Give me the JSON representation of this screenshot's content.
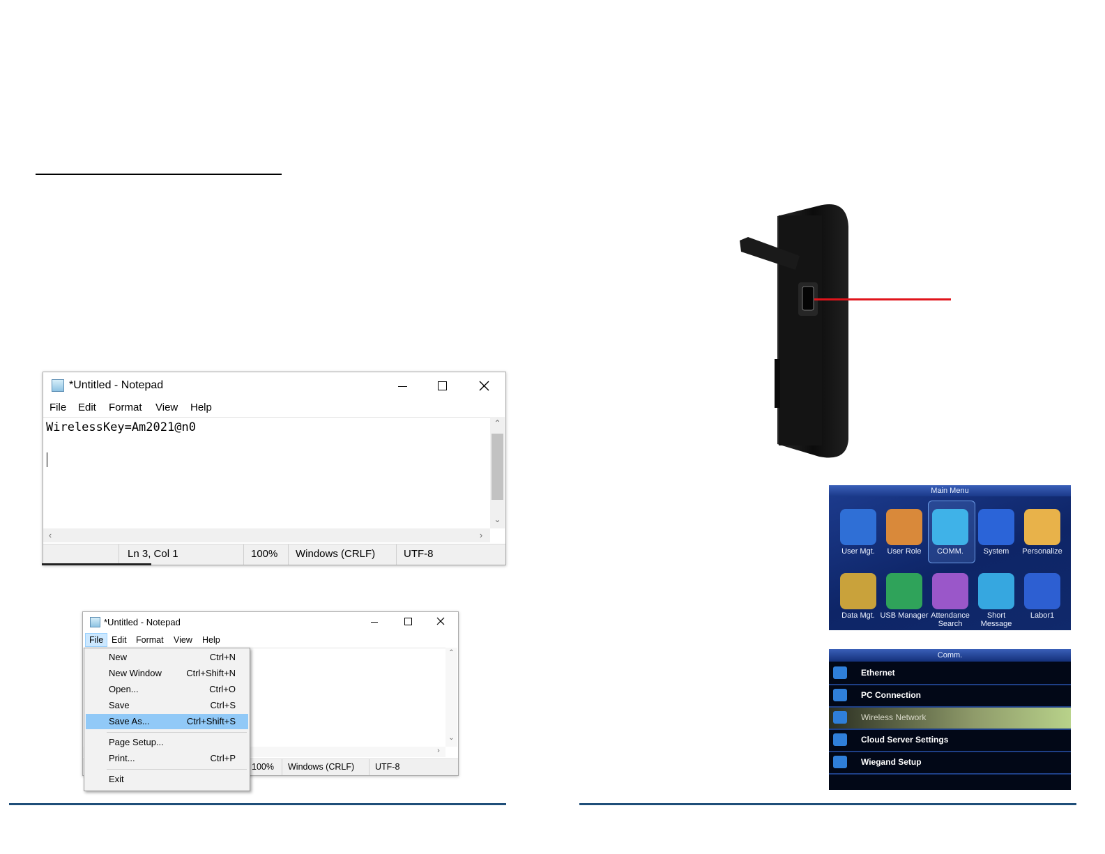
{
  "notepad_large": {
    "title": "*Untitled - Notepad",
    "menu": [
      "File",
      "Edit",
      "Format",
      "View",
      "Help"
    ],
    "content_line1": "WirelessKey=Am2021@n0",
    "status": [
      "Ln 3, Col 1",
      "100%",
      "Windows (CRLF)",
      "UTF-8"
    ]
  },
  "notepad_small": {
    "title": "*Untitled - Notepad",
    "menu": [
      "File",
      "Edit",
      "Format",
      "View",
      "Help"
    ],
    "file_menu": [
      {
        "label": "New",
        "shortcut": "Ctrl+N"
      },
      {
        "label": "New Window",
        "shortcut": "Ctrl+Shift+N"
      },
      {
        "label": "Open...",
        "shortcut": "Ctrl+O"
      },
      {
        "label": "Save",
        "shortcut": "Ctrl+S"
      },
      {
        "label": "Save As...",
        "shortcut": "Ctrl+Shift+S",
        "selected": true
      },
      {
        "label": "Page Setup...",
        "shortcut": ""
      },
      {
        "label": "Print...",
        "shortcut": "Ctrl+P"
      },
      {
        "label": "Exit",
        "shortcut": ""
      }
    ],
    "status": [
      "100%",
      "Windows (CRLF)",
      "UTF-8"
    ]
  },
  "main_menu": {
    "title": "Main Menu",
    "items": [
      {
        "label": "User Mgt.",
        "color": "#2f6fd6"
      },
      {
        "label": "User Role",
        "color": "#d9893a"
      },
      {
        "label": "COMM.",
        "color": "#3fb2e8"
      },
      {
        "label": "System",
        "color": "#2b64d8"
      },
      {
        "label": "Personalize",
        "color": "#e8b24a"
      },
      {
        "label": "Data Mgt.",
        "color": "#c9a23b"
      },
      {
        "label": "USB Manager",
        "color": "#2fa35a"
      },
      {
        "label": "Attendance Search",
        "color": "#9a57c9"
      },
      {
        "label": "Short Message",
        "color": "#36a7e0"
      },
      {
        "label": "Labor1",
        "color": "#2d5fd2"
      }
    ]
  },
  "comm_menu": {
    "title": "Comm.",
    "items": [
      "Ethernet",
      "PC Connection",
      "Wireless Network",
      "Cloud Server Settings",
      "Wiegand Setup"
    ],
    "selected_index": 2
  },
  "colors": {
    "footer_rule": "#1f4e79",
    "pointer_line": "#e0141b",
    "selection": "#91c9f7"
  }
}
